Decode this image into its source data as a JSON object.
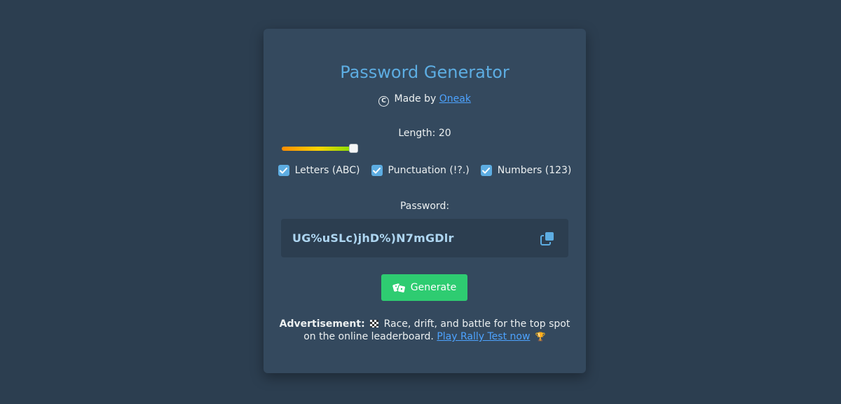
{
  "app": {
    "title": "Password Generator",
    "credit_prefix": "Made by",
    "credit_author": "Oneak"
  },
  "length": {
    "label": "Length: 20",
    "value": 20,
    "fill_fraction": 0.9
  },
  "options": [
    {
      "label": "Letters (ABC)",
      "checked": true
    },
    {
      "label": "Punctuation (!?.)",
      "checked": true
    },
    {
      "label": "Numbers (123)",
      "checked": true
    }
  ],
  "password": {
    "label": "Password:",
    "value": "UG%uSLc)jhD%)N7mGDlr"
  },
  "generate": {
    "label": "Generate"
  },
  "ad": {
    "heading": "Advertisement:",
    "text": "Race, drift, and battle for the top spot on the online leaderboard.",
    "link": "Play Rally Test now"
  },
  "colors": {
    "background": "#2c3e50",
    "card": "#34495e",
    "accent": "#5dade2",
    "button": "#2ecc71",
    "link": "#4da3ff"
  },
  "icons": {
    "credit": "copyright-icon",
    "copy": "copy-icon",
    "generate": "dice-icon",
    "ad_flag": "checkered-flag-icon",
    "ad_trophy": "trophy-icon"
  }
}
